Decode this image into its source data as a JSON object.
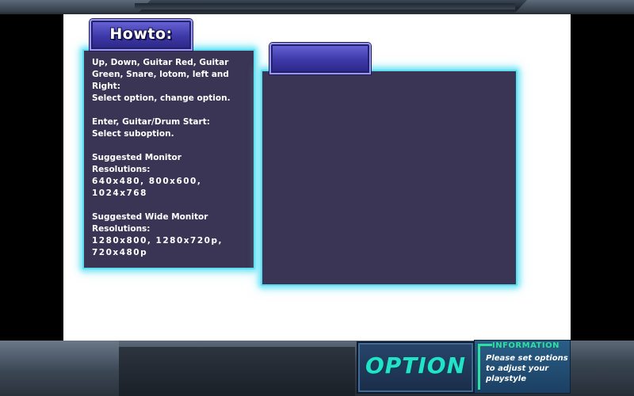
{
  "howto": {
    "title": "Howto:",
    "lines": [
      "Up, Down, Guitar Red, Guitar",
      "Green, Snare, lotom, left and",
      "Right:",
      "Select option, change option.",
      "",
      "Enter, Guitar/Drum Start:",
      "Select suboption.",
      "",
      "Suggested Monitor",
      "Resolutions:",
      "640x480, 800x600,",
      "1024x768",
      "",
      "Suggested Wide Monitor",
      "Resolutions:",
      "1280x800, 1280x720p,",
      "720x480p"
    ]
  },
  "detail_panel": {
    "title": ""
  },
  "footer": {
    "option_label": "OPTION",
    "info_heading": "INFORMATION",
    "info_message": "Please set options to adjust your playstyle"
  },
  "colors": {
    "panel_bg": "#3a3554",
    "panel_glow": "#7fe8f6",
    "tab_blue": "#3d38a8",
    "option_text": "#21e3c8",
    "info_heading": "#2ee0a0"
  }
}
